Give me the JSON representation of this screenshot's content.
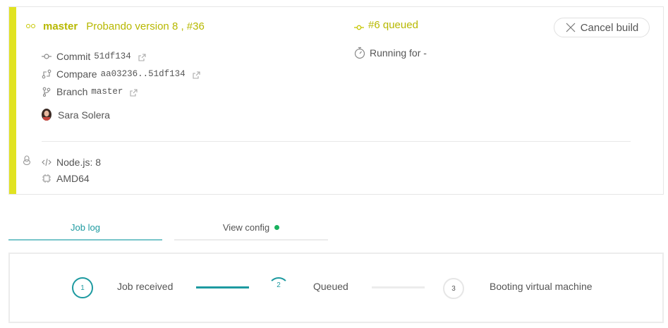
{
  "header": {
    "branch": "master",
    "message": "Probando version 8 , #36"
  },
  "commit": {
    "label": "Commit",
    "sha": "51df134"
  },
  "compare": {
    "label": "Compare",
    "range": "aa03236..51df134"
  },
  "branch": {
    "label": "Branch",
    "name": "master"
  },
  "author": {
    "name": "Sara Solera"
  },
  "env": {
    "language": "Node.js: 8",
    "arch": "AMD64"
  },
  "status": {
    "queued": "#6 queued",
    "running": "Running for -"
  },
  "actions": {
    "cancel_label": "Cancel build"
  },
  "tabs": [
    {
      "label": "Job log",
      "active": true
    },
    {
      "label": "View config",
      "status_color": "#19b15e"
    }
  ],
  "steps": [
    {
      "number": "1",
      "label": "Job received",
      "state": "done"
    },
    {
      "number": "2",
      "label": "Queued",
      "state": "active"
    },
    {
      "number": "3",
      "label": "Booting virtual machine",
      "state": "pending"
    }
  ],
  "colors": {
    "status_accent": "#e1e321",
    "status_text": "#b7b800",
    "teal": "#1d9aa0",
    "config_dot": "#19b15e"
  }
}
